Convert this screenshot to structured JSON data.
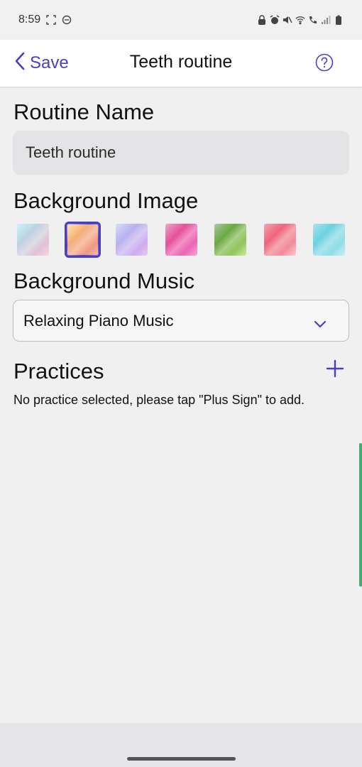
{
  "status_bar": {
    "time": "8:59",
    "left_icons": [
      "screenshot-frame-icon",
      "do-not-disturb-icon"
    ],
    "right_icons": [
      "lock-icon",
      "alarm-icon",
      "mute-icon",
      "wifi-icon",
      "call-icon",
      "signal-icon",
      "battery-icon"
    ]
  },
  "nav": {
    "back_label": "Save",
    "title": "Teeth routine",
    "help_icon": "help-circle-icon",
    "accent_color": "#4a3fc0"
  },
  "routine_name": {
    "heading": "Routine Name",
    "value": "Teeth routine"
  },
  "background_image": {
    "heading": "Background Image",
    "options": [
      {
        "name": "bg-option-1",
        "colors": [
          "#9fe0ea",
          "#f4b7d2"
        ],
        "selected": false
      },
      {
        "name": "bg-option-2",
        "colors": [
          "#f7c36a",
          "#f08a8a"
        ],
        "selected": true
      },
      {
        "name": "bg-option-3",
        "colors": [
          "#a9b4f0",
          "#d9a9ea"
        ],
        "selected": false
      },
      {
        "name": "bg-option-4",
        "colors": [
          "#e0408a",
          "#f070c0"
        ],
        "selected": false
      },
      {
        "name": "bg-option-5",
        "colors": [
          "#4e8f2d",
          "#a6d86a"
        ],
        "selected": false
      },
      {
        "name": "bg-option-6",
        "colors": [
          "#e8455a",
          "#f7a3b0"
        ],
        "selected": false
      },
      {
        "name": "bg-option-7",
        "colors": [
          "#4fc6d8",
          "#a7e6ef"
        ],
        "selected": false
      }
    ]
  },
  "background_music": {
    "heading": "Background Music",
    "selected": "Relaxing Piano Music"
  },
  "practices": {
    "heading": "Practices",
    "empty_message": "No practice selected, please tap \"Plus Sign\" to add."
  }
}
